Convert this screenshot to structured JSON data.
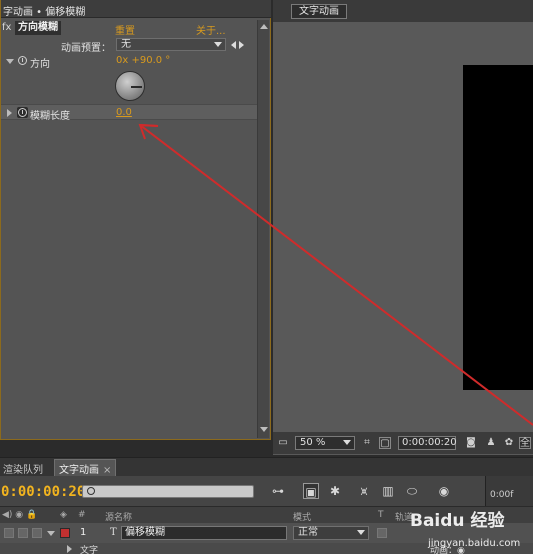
{
  "effect_controls": {
    "title": "字动画 • 偏移模糊",
    "fx_badge": "fx",
    "effect_name": "方向模糊",
    "reset": "重置",
    "about": "关于...",
    "preset_label": "动画预置：",
    "preset_value": "无",
    "direction_label": "方向",
    "direction_value": "0x +90.0 °",
    "blur_length_label": "模糊长度",
    "blur_length_value": "0.0"
  },
  "composition": {
    "tab_label": "文字动画",
    "zoom": "50 %",
    "timecode": "0:00:00:20",
    "overflow_label": "全"
  },
  "timeline": {
    "tab_render_queue": "渲染队列",
    "tab_comp": "文字动画",
    "timecode": "0:00:00:20",
    "ruler_label": "0:00f",
    "headers": {
      "col_hash": "#",
      "col_source": "源名称",
      "col_mode": "模式",
      "col_t": "T",
      "col_trkmat": "轨道"
    },
    "layer": {
      "number": "1",
      "type_icon": "T",
      "name": "偏移模糊",
      "mode": "正常"
    },
    "sub_row": {
      "label": "文字",
      "animate": "动画：◉"
    }
  },
  "watermark": {
    "logo": "Baidu 经验",
    "url": "jingyan.baidu.com"
  },
  "annotation": {
    "arrow_color": "#d02b2b"
  },
  "colors": {
    "accent_orange": "#d89a1e",
    "timecode_yellow": "#f2b41f",
    "layer_label_red": "#c03030"
  }
}
